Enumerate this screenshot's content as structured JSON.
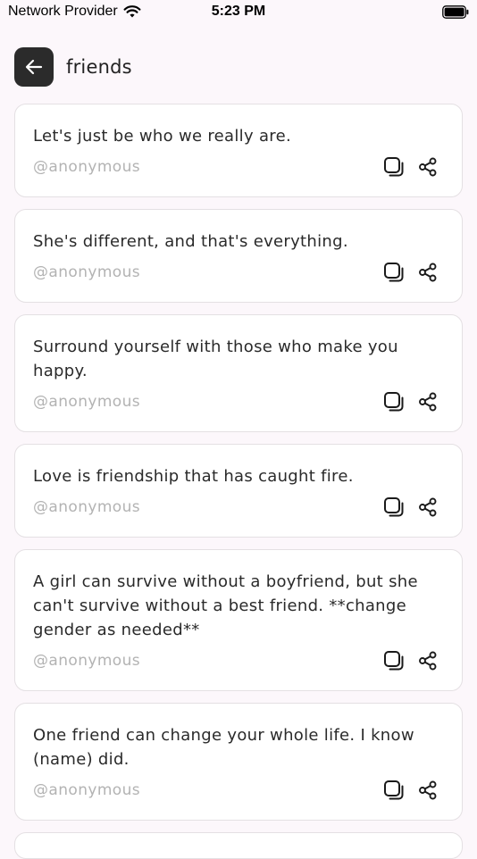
{
  "status_bar": {
    "carrier": "Network Provider",
    "time": "5:23 PM"
  },
  "header": {
    "title": "friends"
  },
  "quotes": [
    {
      "text": "Let's just be who we really are.",
      "author": "@anonymous"
    },
    {
      "text": "She's different, and that's everything.",
      "author": "@anonymous"
    },
    {
      "text": "Surround yourself with those who make you happy.",
      "author": "@anonymous"
    },
    {
      "text": "Love is friendship that has caught fire.",
      "author": "@anonymous"
    },
    {
      "text": "A girl can survive without a boyfriend, but she can't survive without a best friend. **change gender as needed**",
      "author": "@anonymous"
    },
    {
      "text": "One friend can change your whole life. I know (name) did.",
      "author": "@anonymous"
    }
  ],
  "colors": {
    "background": "#fcf7fb",
    "card": "#ffffff",
    "back_button": "#2b2b2b",
    "author_text": "#b3b3b3"
  },
  "icons": {
    "back": "arrow-left-icon",
    "copy": "copy-icon",
    "share": "share-icon"
  }
}
